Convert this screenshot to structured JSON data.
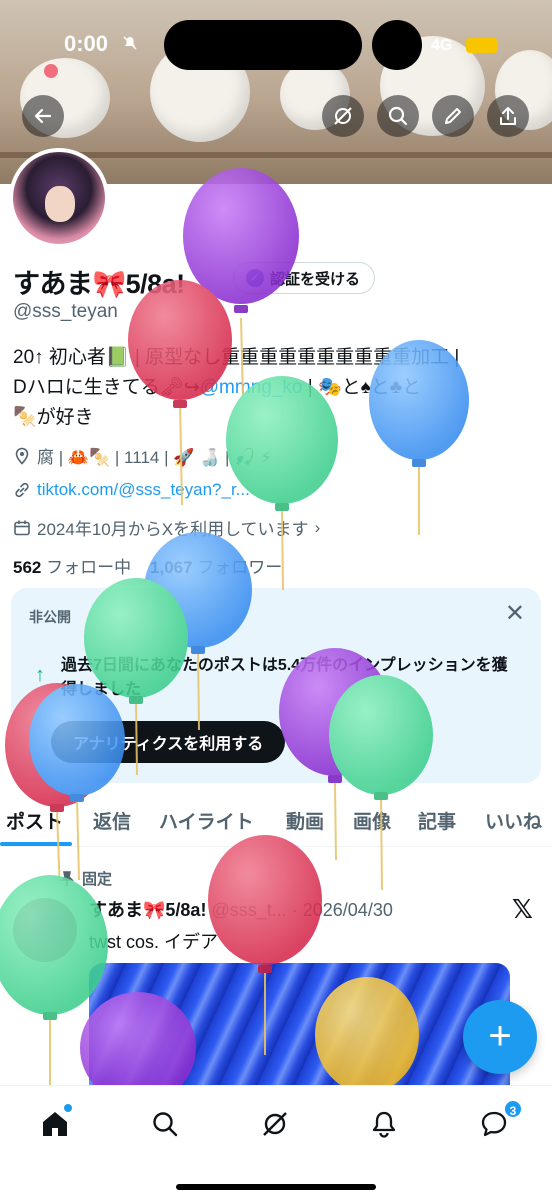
{
  "status_bar": {
    "time": "0:00",
    "network": "4G"
  },
  "header": {
    "back_icon": "back-arrow-icon",
    "grok_icon": "grok-icon",
    "search_icon": "search-icon",
    "edit_icon": "pencil-icon",
    "share_icon": "share-icon"
  },
  "profile": {
    "name": "すあま🎀5/8a!",
    "verify_label": "認証を受ける",
    "handle": "@sss_teyan",
    "bio_line1_a": "20↑ 初心者📗 | 原型なし重重重重重重重重重重加工 |",
    "bio_line2_a": "Dハロに生きてる🗝↪",
    "bio_mention": "@mmng_ko",
    "bio_line2_b": " | 🎭と♠と♣と",
    "bio_line3": "🍢が好き",
    "location": "腐 | 🦀🍢 | 1114 | 🚀 🍶 | 🎣 ⚡",
    "website": "tiktok.com/@sss_teyan?_r...",
    "joined": "2024年10月からXを利用しています",
    "following_count": "562",
    "following_label": "フォロー中",
    "followers_count": "1,067",
    "followers_label": "フォロワー"
  },
  "private_card": {
    "title": "非公開",
    "message": "過去7日間にあなたのポストは5.4万件のインプレッションを獲得しました",
    "button": "アナリティクスを利用する"
  },
  "tabs": [
    "ポスト",
    "返信",
    "ハイライト",
    "動画",
    "画像",
    "記事",
    "いいね"
  ],
  "pinned_post": {
    "pinned_label": "固定",
    "author": "すあま🎀5/8a!",
    "handle_date": "@sss_t... · 2026/04/30",
    "text": "twst cos. イデア"
  },
  "nav_badge": "3",
  "colors": {
    "accent": "#1d9bf0",
    "text": "#0f1419",
    "muted": "#536471",
    "card_bg": "#e8f5fd"
  }
}
